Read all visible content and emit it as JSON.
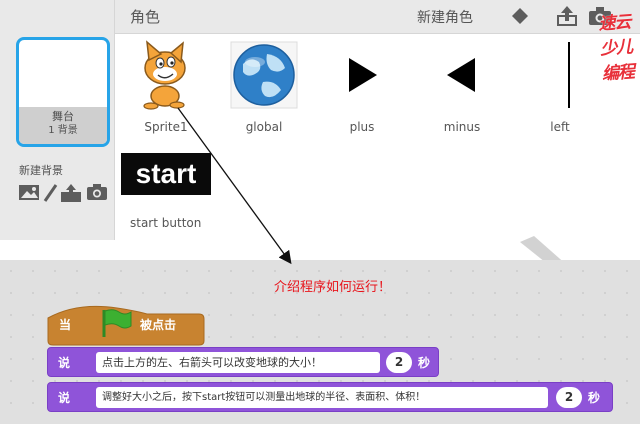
{
  "header": {
    "title": "角色",
    "new_sprite_label": "新建角色",
    "watermark": "速云少儿编程"
  },
  "stage": {
    "label": "舞台",
    "backdrop_count": "1 背景",
    "new_backdrop_label": "新建背景"
  },
  "sprites": [
    {
      "name": "Sprite1",
      "icon": "cat-sprite-icon"
    },
    {
      "name": "global",
      "icon": "globe-icon"
    },
    {
      "name": "plus",
      "icon": "right-triangle-icon"
    },
    {
      "name": "minus",
      "icon": "left-triangle-icon"
    },
    {
      "name": "left",
      "icon": "vertical-line-icon"
    },
    {
      "name": "start button",
      "icon": "start-text-sprite",
      "thumb_text": "start"
    }
  ],
  "annotation": "介绍程序如何运行！",
  "script": {
    "hat": {
      "when": "当",
      "clicked": "被点击",
      "flag_color": "#3cb031"
    },
    "blocks": [
      {
        "keyword": "说",
        "message": "点击上方的左、右箭头可以改变地球的大小！",
        "seconds": "2",
        "unit": "秒"
      },
      {
        "keyword": "说",
        "message": "调整好大小之后，按下start按钮可以测量出地球的半径、表面积、体积！",
        "seconds": "2",
        "unit": "秒"
      }
    ]
  },
  "colors": {
    "selected_border": "#27a4e8",
    "events_block": "#c88330",
    "looks_block": "#8f54d9",
    "annotation": "#e8141b"
  }
}
